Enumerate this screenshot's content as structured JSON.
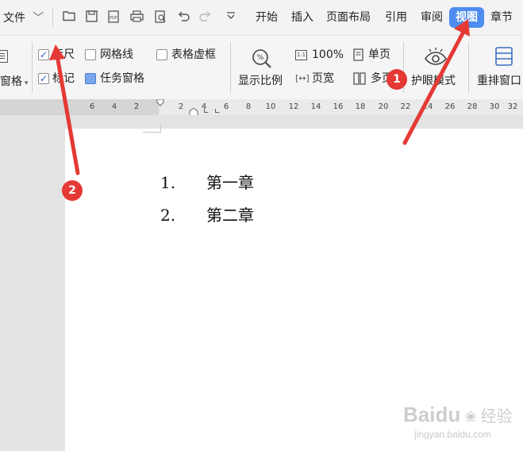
{
  "menubar": {
    "file_label": "文件",
    "tabs": [
      "开始",
      "插入",
      "页面布局",
      "引用",
      "审阅",
      "视图",
      "章节"
    ]
  },
  "ribbon": {
    "left_partial_label": "窗格",
    "ruler_label": "标尺",
    "gridlines_label": "网格线",
    "table_gridlines_label": "表格虚框",
    "markup_label": "标记",
    "task_pane_label": "任务窗格",
    "zoom_label": "显示比例",
    "zoom_value": "100%",
    "page_width_label": "页宽",
    "single_page_label": "单页",
    "multi_page_label": "多页",
    "eye_protect_label": "护眼模式",
    "rearrange_label": "重排窗口"
  },
  "ruler": {
    "ticks": [
      "6",
      "4",
      "2",
      "2",
      "4",
      "6",
      "8",
      "10",
      "12",
      "14",
      "16",
      "18",
      "20",
      "22",
      "24",
      "26",
      "28",
      "30",
      "32"
    ]
  },
  "document": {
    "items": [
      {
        "num": "1.",
        "text": "第一章"
      },
      {
        "num": "2.",
        "text": "第二章"
      }
    ]
  },
  "annotations": {
    "badge1": "1",
    "badge2": "2",
    "color": "#e53935"
  },
  "watermark": {
    "brand": "Baidu",
    "sub": "经验",
    "url": "jingyan.baidu.com"
  },
  "colors": {
    "accent": "#4d8df0",
    "annotation": "#e53935"
  }
}
